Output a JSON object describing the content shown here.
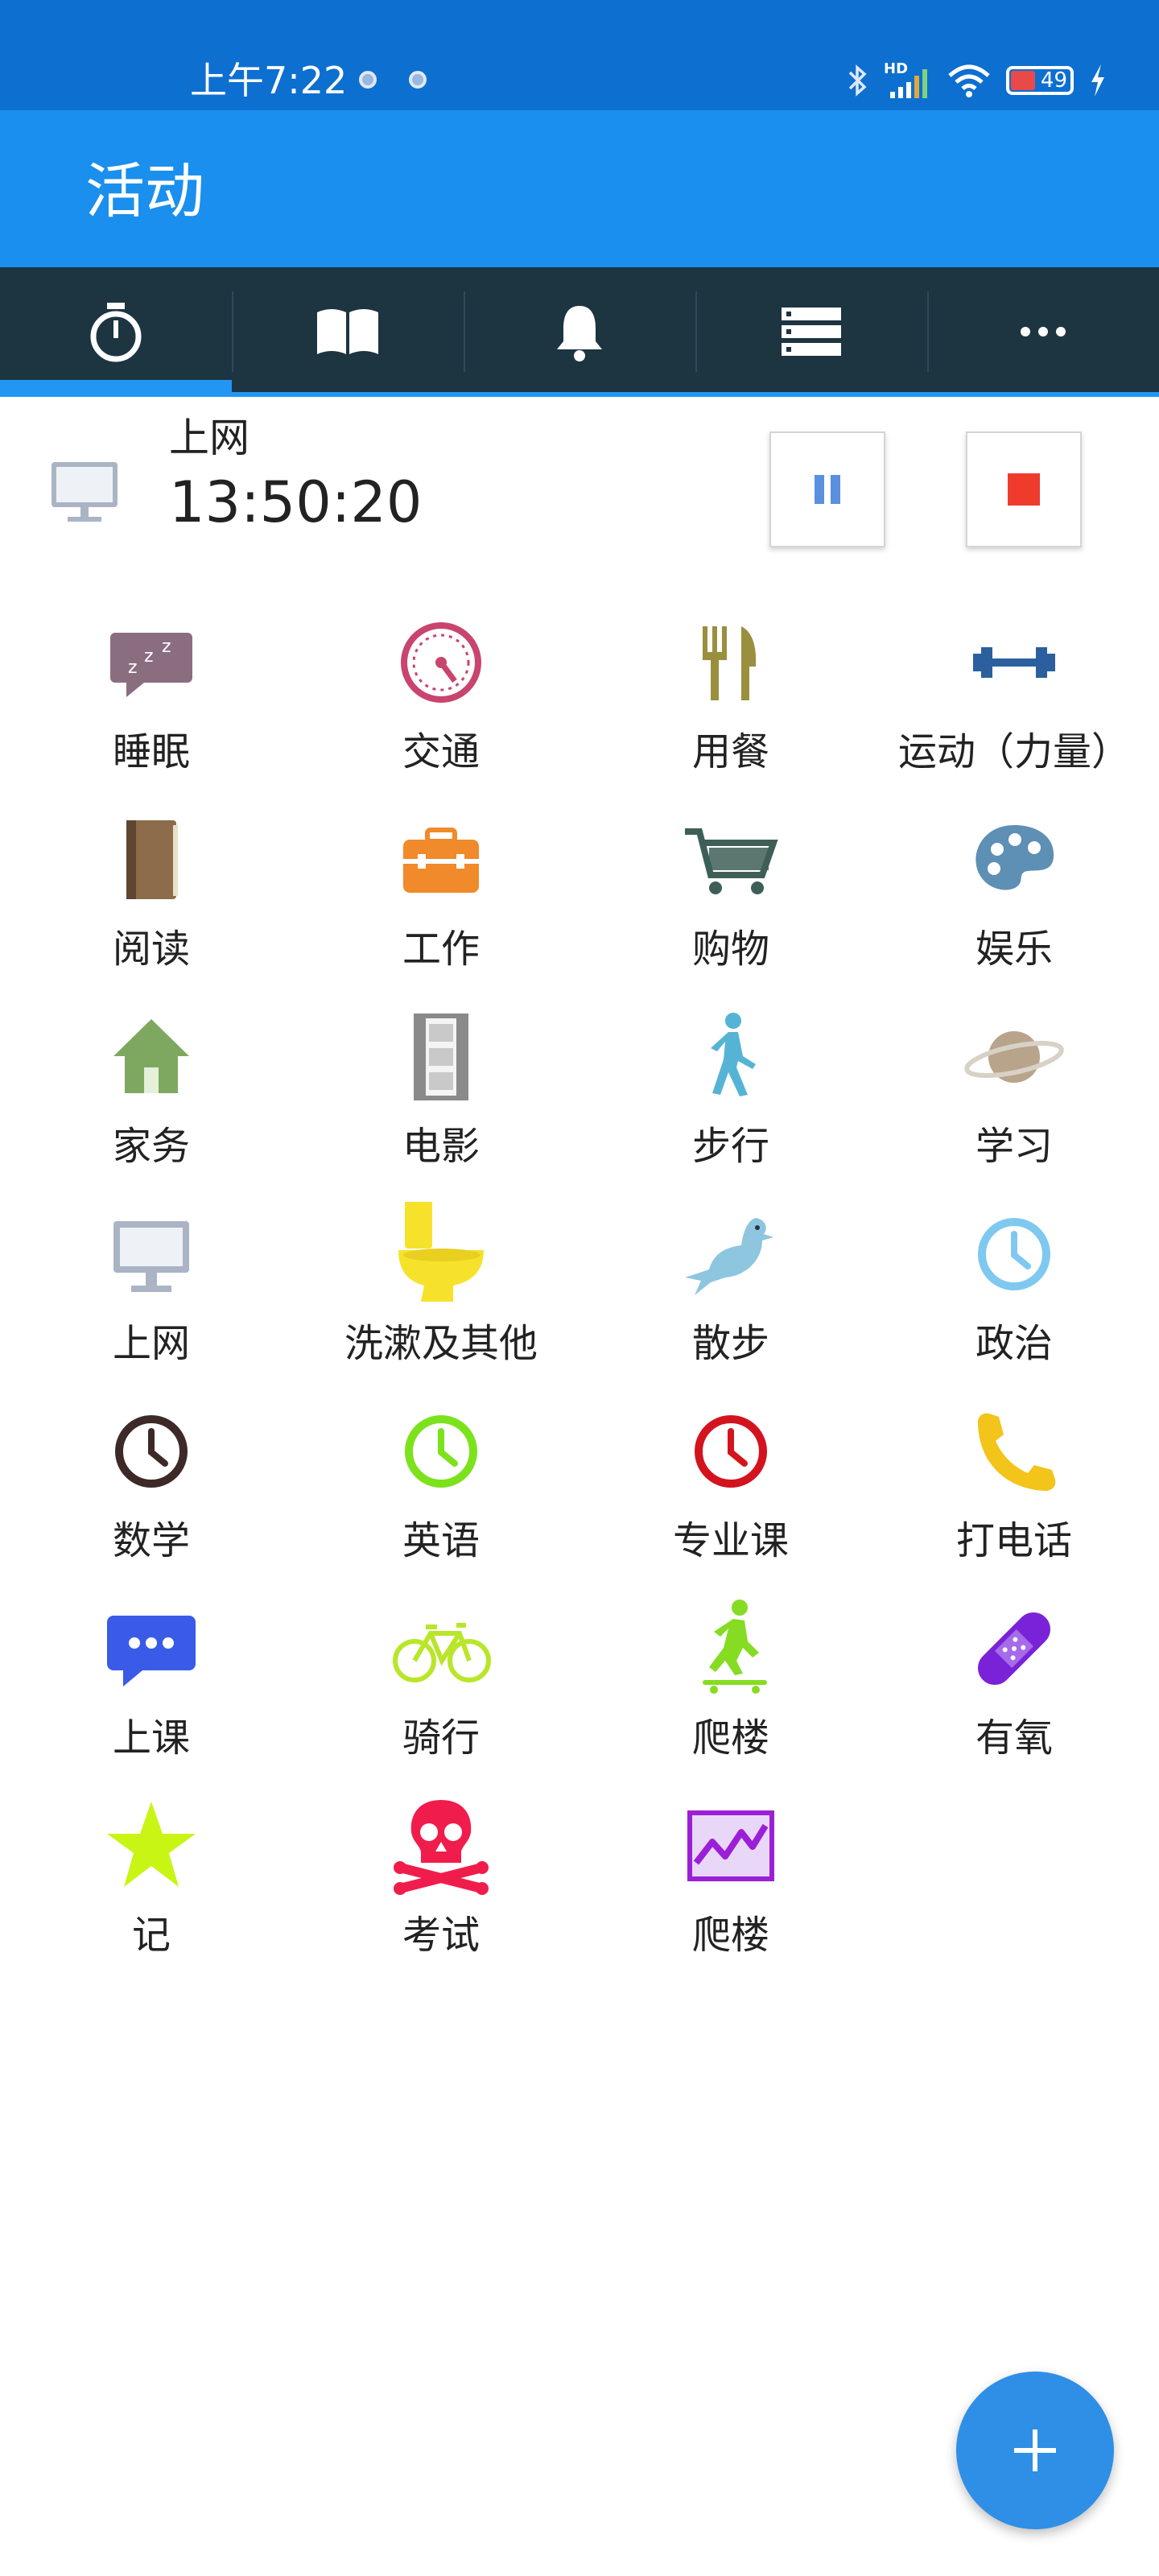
{
  "status_bar": {
    "time": "上午7:22",
    "network_label": "HD",
    "battery_level": "49"
  },
  "app_bar": {
    "title": "活动"
  },
  "tabs": [
    {
      "icon": "stopwatch-icon",
      "active": true
    },
    {
      "icon": "book-icon",
      "active": false
    },
    {
      "icon": "bell-icon",
      "active": false
    },
    {
      "icon": "list-icon",
      "active": false
    },
    {
      "icon": "more-icon",
      "active": false
    }
  ],
  "current_activity": {
    "name": "上网",
    "elapsed": "13:50:20",
    "icon": "monitor-icon"
  },
  "activities": [
    {
      "label": "睡眠",
      "icon": "sleep-icon",
      "color": "#8b6d80"
    },
    {
      "label": "交通",
      "icon": "speedometer-icon",
      "color": "#c9446f"
    },
    {
      "label": "用餐",
      "icon": "fork-knife-icon",
      "color": "#9a8f3e"
    },
    {
      "label": "运动（力量）",
      "icon": "dumbbell-icon",
      "color": "#2b5f9e"
    },
    {
      "label": "阅读",
      "icon": "book-icon",
      "color": "#8c6c4a"
    },
    {
      "label": "工作",
      "icon": "briefcase-icon",
      "color": "#f08a2a"
    },
    {
      "label": "购物",
      "icon": "cart-icon",
      "color": "#3e5f57"
    },
    {
      "label": "娱乐",
      "icon": "palette-icon",
      "color": "#5e8fb5"
    },
    {
      "label": "家务",
      "icon": "house-icon",
      "color": "#7ea85f"
    },
    {
      "label": "电影",
      "icon": "film-icon",
      "color": "#8a8a8a"
    },
    {
      "label": "步行",
      "icon": "walk-icon",
      "color": "#55b4d6"
    },
    {
      "label": "学习",
      "icon": "planet-icon",
      "color": "#b8a48a"
    },
    {
      "label": "上网",
      "icon": "monitor-icon",
      "color": "#aab4c4"
    },
    {
      "label": "洗漱及其他",
      "icon": "toilet-icon",
      "color": "#f6e22b"
    },
    {
      "label": "散步",
      "icon": "pigeon-icon",
      "color": "#8ec6df"
    },
    {
      "label": "政治",
      "icon": "clock-icon",
      "color": "#7fc8ef"
    },
    {
      "label": "数学",
      "icon": "clock-icon",
      "color": "#3d2a28"
    },
    {
      "label": "英语",
      "icon": "clock-icon",
      "color": "#7ce21c"
    },
    {
      "label": "专业课",
      "icon": "clock-icon",
      "color": "#d3141e"
    },
    {
      "label": "打电话",
      "icon": "phone-icon",
      "color": "#f3c419"
    },
    {
      "label": "上课",
      "icon": "chat-icon",
      "color": "#3a5be8"
    },
    {
      "label": "骑行",
      "icon": "bicycle-icon",
      "color": "#b9e62a"
    },
    {
      "label": "爬楼",
      "icon": "skateboard-icon",
      "color": "#86dc22"
    },
    {
      "label": "有氧",
      "icon": "bandage-icon",
      "color": "#7a22d8"
    },
    {
      "label": "记",
      "icon": "star-icon",
      "color": "#c9f514"
    },
    {
      "label": "考试",
      "icon": "skull-icon",
      "color": "#f01d4c"
    },
    {
      "label": "爬楼",
      "icon": "chart-icon",
      "color": "#9b1fd6"
    }
  ],
  "fab": {
    "icon": "plus-icon"
  }
}
